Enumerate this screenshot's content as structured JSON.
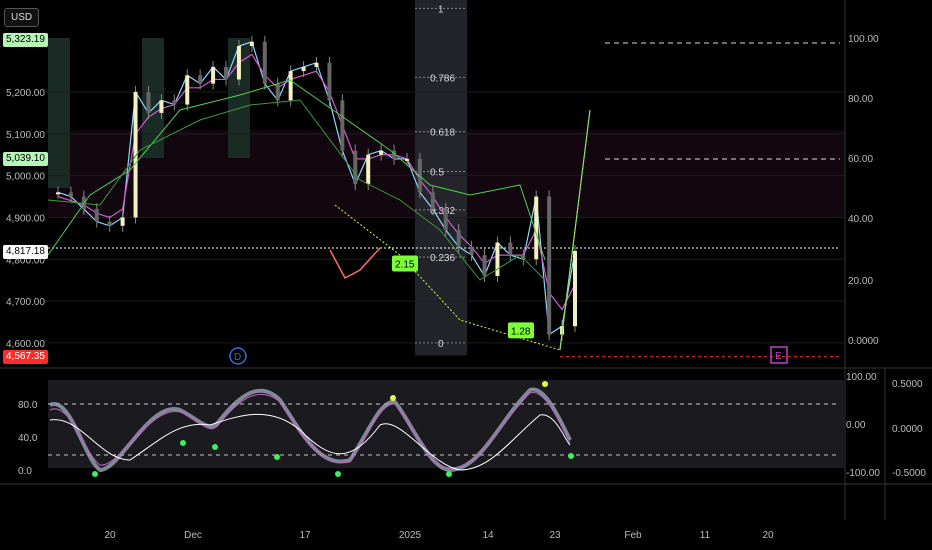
{
  "toolbar": {
    "currency": "USD"
  },
  "chart_data": {
    "type": "line",
    "ylim": [
      4540,
      5420
    ],
    "yticks": [
      4600,
      4700,
      4800,
      4900,
      5000,
      5100,
      5200
    ],
    "ytick_labels": [
      "4,600.00",
      "4,700.00",
      "4,800.00",
      "4,900.00",
      "5,000.00",
      "5,100.00",
      "5,200.00"
    ],
    "price_badges": [
      {
        "value": 5323.19,
        "label": "5,323.19",
        "color": "#b6f5b6"
      },
      {
        "value": 5039.1,
        "label": "5,039.10",
        "color": "#b6f5b6"
      },
      {
        "value": 4817.18,
        "label": "4,817.18",
        "color": "#ffffff"
      },
      {
        "value": 4567.35,
        "label": "4,567.35",
        "color": "#ff2b2b"
      }
    ],
    "osc_right_ticks": [
      "100.00",
      "80.00",
      "60.00",
      "40.00",
      "20.00",
      "0.0000"
    ],
    "x_tick_labels": [
      "20",
      "Dec",
      "17",
      "2025",
      "14",
      "23",
      "Feb",
      "11",
      "20"
    ],
    "fib_levels": [
      {
        "label": "1",
        "value": 5400
      },
      {
        "label": "0.786",
        "value": 5235
      },
      {
        "label": "0.618",
        "value": 5105
      },
      {
        "label": "0.5",
        "value": 5010
      },
      {
        "label": "0.382",
        "value": 4918
      },
      {
        "label": "0.236",
        "value": 4805
      },
      {
        "label": "0",
        "value": 4600
      }
    ],
    "pattern_labels": [
      {
        "label": "2.15",
        "value": 4790
      },
      {
        "label": "1.28",
        "value": 4630
      }
    ],
    "markers": [
      "D",
      "E"
    ],
    "sub_left_ticks": [
      "80.0",
      "40.0",
      "0.0"
    ],
    "sub_mid_ticks": [
      "100.00",
      "0.00",
      "-100.00"
    ],
    "sub_right_ticks": [
      "0.5000",
      "0.0000",
      "-0.5000"
    ],
    "series": [
      {
        "values": [
          4960,
          4950,
          4920,
          4890,
          4880,
          4900,
          5200,
          5150,
          5180,
          5170,
          5240,
          5220,
          5260,
          5230,
          5310,
          5320,
          5220,
          5180,
          5250,
          5260,
          5270,
          5180,
          5060,
          4980,
          5050,
          5060,
          5040,
          5040,
          4960,
          4920,
          4870,
          4830,
          4810,
          4760,
          4840,
          4810,
          4800,
          4950,
          4620,
          4640,
          4820
        ]
      },
      {
        "values": [
          4950,
          4940,
          4930,
          4910,
          4900,
          4920,
          5100,
          5140,
          5160,
          5170,
          5210,
          5210,
          5230,
          5230,
          5270,
          5290,
          5240,
          5210,
          5230,
          5240,
          5250,
          5200,
          5120,
          5040,
          5040,
          5050,
          5050,
          5040,
          4990,
          4950,
          4900,
          4860,
          4830,
          4790,
          4810,
          4810,
          4810,
          4870,
          4720,
          4680,
          4740
        ]
      }
    ]
  }
}
